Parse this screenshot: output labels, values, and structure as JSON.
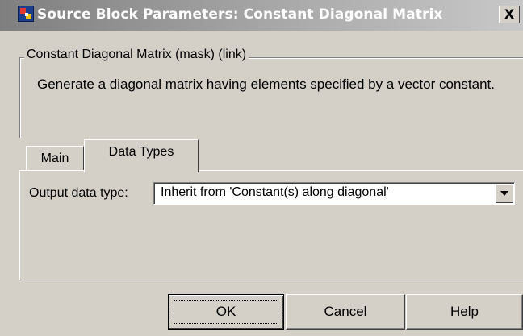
{
  "window": {
    "title": "Source Block Parameters: Constant Diagonal Matrix",
    "close_glyph": "X",
    "icon": "simulink-block-icon"
  },
  "description_group": {
    "legend": "Constant Diagonal Matrix (mask) (link)",
    "text": "Generate a diagonal matrix having elements specified by a vector constant."
  },
  "tabs": [
    {
      "label": "Main",
      "selected": false
    },
    {
      "label": "Data Types",
      "selected": true
    }
  ],
  "data_types": {
    "output_label": "Output data type:",
    "output_value": "Inherit from 'Constant(s) along diagonal'"
  },
  "buttons": {
    "ok": "OK",
    "cancel": "Cancel",
    "help": "Help"
  }
}
